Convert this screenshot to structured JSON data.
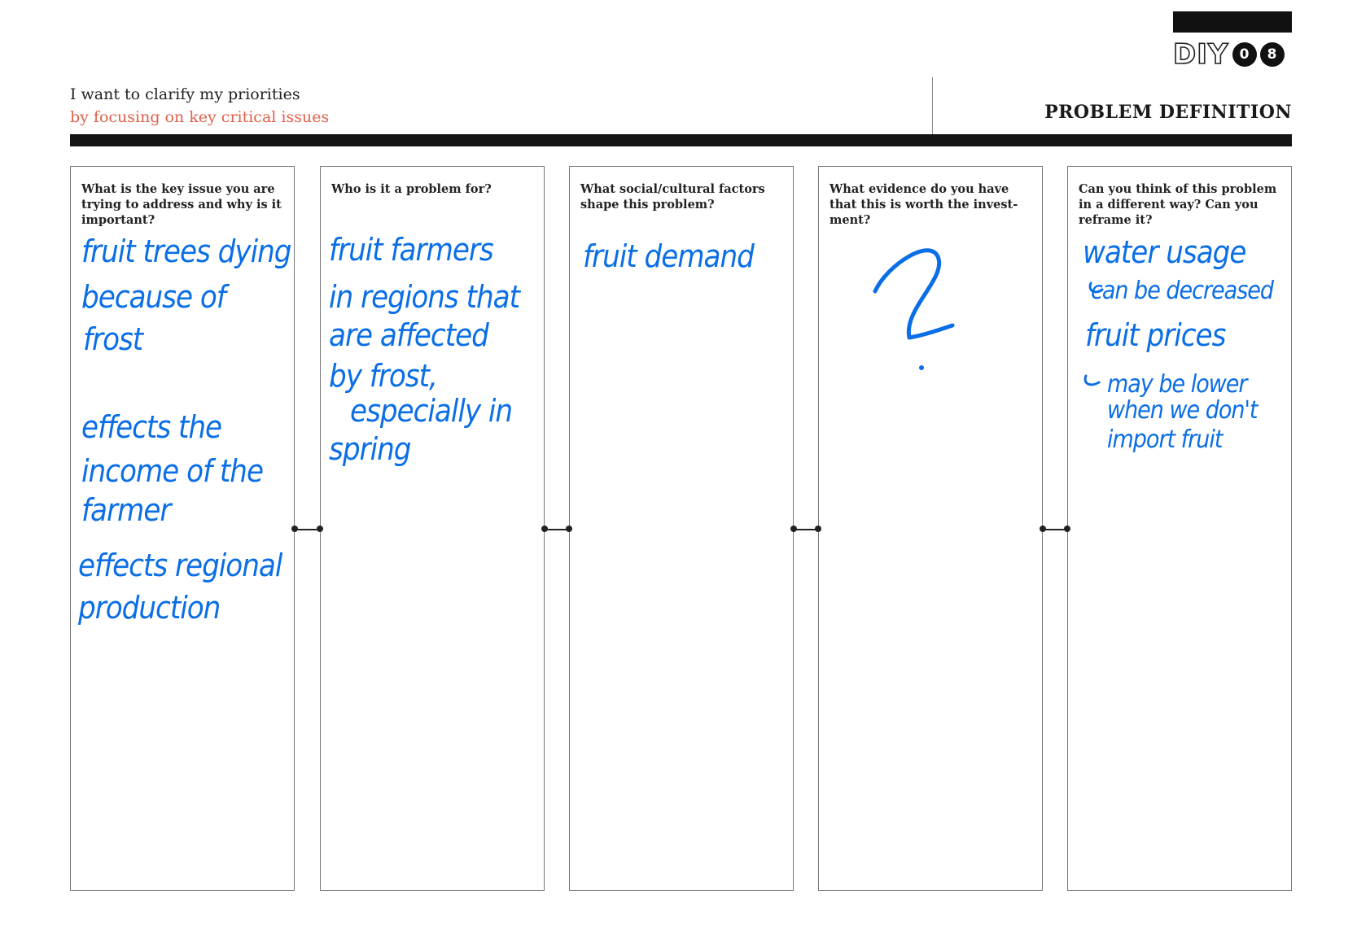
{
  "header": {
    "logo_text": "DIY",
    "logo_digits": [
      "0",
      "8"
    ],
    "intro_line1": "I want to clarify my priorities",
    "intro_line2": "by focusing on key critical issues",
    "title": "PROBLEM DEFINITION"
  },
  "colors": {
    "accent_red": "#e0604a",
    "ink_blue": "#0a6ee6",
    "rule_black": "#141414"
  },
  "cards": [
    {
      "question": "What is the key issue you are trying to address and why is it important?",
      "handwriting": [
        "fruit trees dying",
        "because of",
        "frost",
        "effects the",
        "income of the",
        "farmer",
        "effects regional",
        "production"
      ]
    },
    {
      "question": "Who is it a problem for?",
      "handwriting": [
        "fruit farmers",
        "in regions that",
        "are affected",
        "by frost,",
        "especially in",
        "spring"
      ]
    },
    {
      "question": "What social/cultural factors  shape this problem?",
      "handwriting": [
        "fruit demand"
      ]
    },
    {
      "question": "What evidence do you have that this is worth the invest-ment?",
      "handwriting": [
        "?"
      ]
    },
    {
      "question": "Can you think of this problem in a different way? Can you reframe it?",
      "handwriting": [
        "water usage",
        "can be decreased",
        "fruit prices",
        "may be lower",
        "when we don't",
        "import fruit"
      ]
    }
  ]
}
